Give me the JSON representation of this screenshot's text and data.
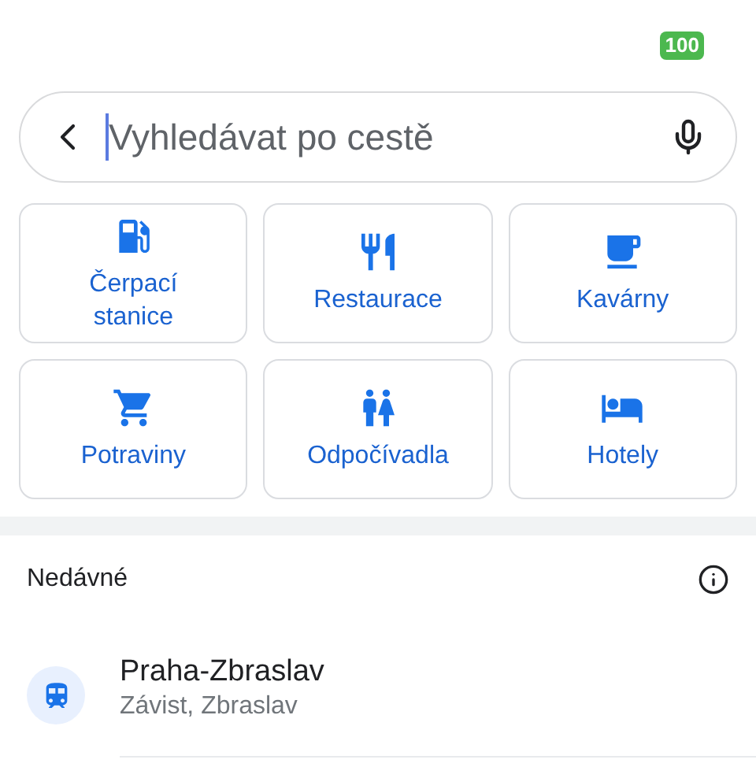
{
  "status_bar": {
    "battery": "100"
  },
  "search": {
    "placeholder": "Vyhledávat po cestě"
  },
  "categories": [
    {
      "kind": "gas",
      "label": "Čerpací stanice"
    },
    {
      "kind": "restaurant",
      "label": "Restaurace"
    },
    {
      "kind": "cafe",
      "label": "Kavárny"
    },
    {
      "kind": "grocery",
      "label": "Potraviny"
    },
    {
      "kind": "restroom",
      "label": "Odpočívadla"
    },
    {
      "kind": "hotel",
      "label": "Hotely"
    }
  ],
  "recent": {
    "title": "Nedávné",
    "items": [
      {
        "kind": "train",
        "title": "Praha-Zbraslav",
        "subtitle": "Závist, Zbraslav"
      }
    ]
  }
}
